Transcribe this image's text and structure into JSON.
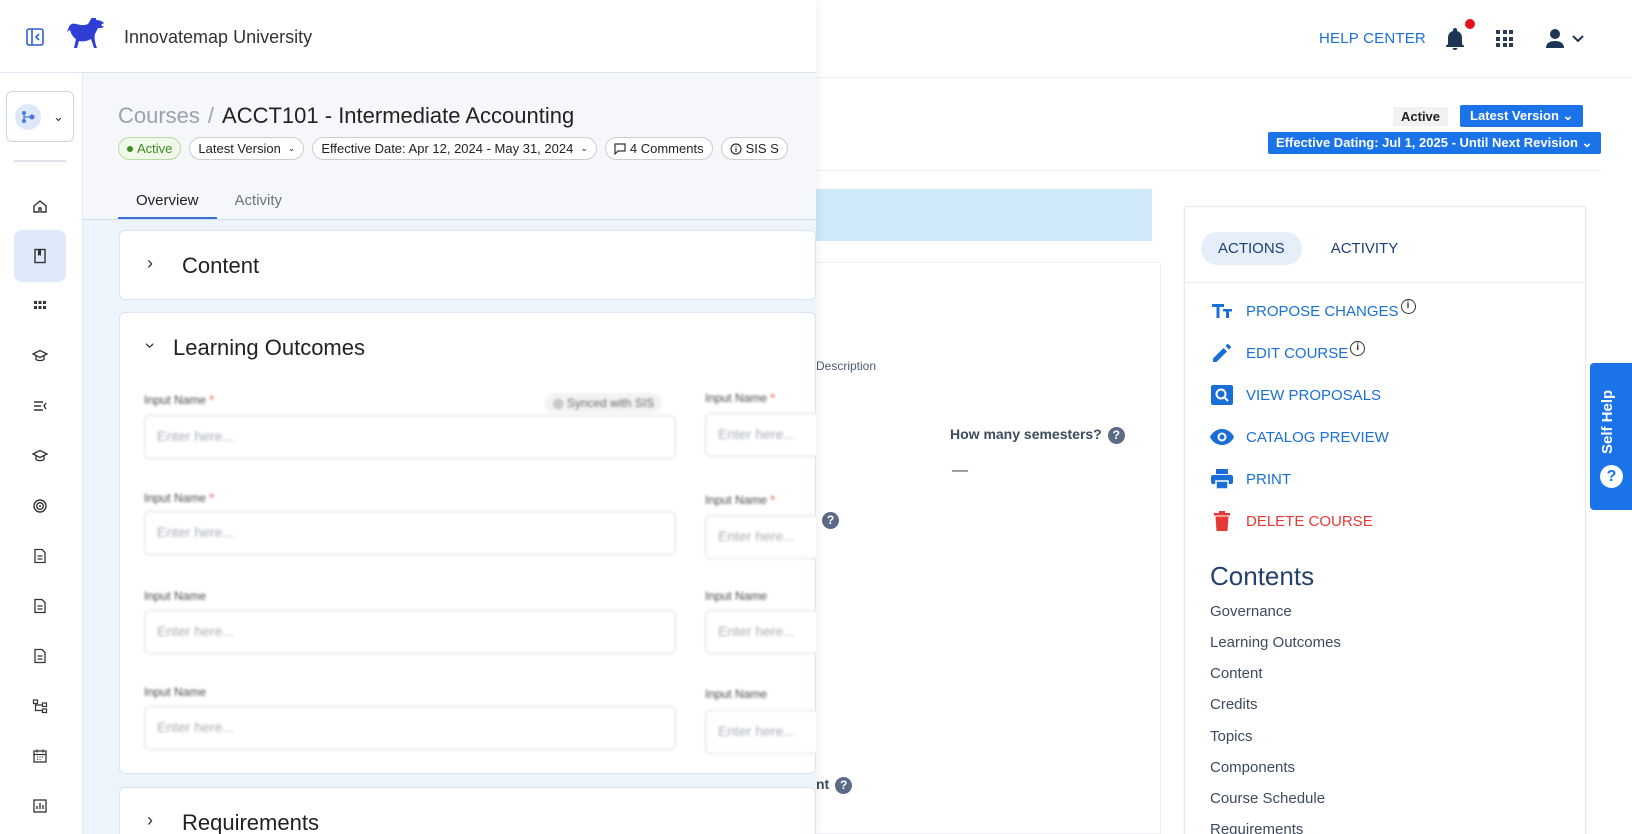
{
  "underlying": {
    "header": {
      "help_center": "HELP CENTER",
      "icons": [
        "bell-icon",
        "apps-grid-icon",
        "user-icon",
        "chevron-down-icon"
      ]
    },
    "status": {
      "active": "Active",
      "version": "Latest Version",
      "effective_dating": "Effective Dating: Jul 1, 2025 - Until Next Revision"
    },
    "form": {
      "description_label": "Description",
      "semesters_label": "How many semesters?",
      "semesters_value": "—",
      "partial_label": "nt"
    },
    "actions_panel": {
      "tabs": [
        "ACTIONS",
        "ACTIVITY"
      ],
      "items": [
        {
          "label": "PROPOSE CHANGES",
          "icon": "text-format-icon"
        },
        {
          "label": "EDIT COURSE",
          "icon": "pencil-icon"
        },
        {
          "label": "VIEW PROPOSALS",
          "icon": "search-box-icon"
        },
        {
          "label": "CATALOG PREVIEW",
          "icon": "eye-icon"
        },
        {
          "label": "PRINT",
          "icon": "printer-icon"
        },
        {
          "label": "DELETE COURSE",
          "icon": "trash-icon"
        }
      ],
      "contents_heading": "Contents",
      "contents": [
        "Governance",
        "Learning Outcomes",
        "Content",
        "Credits",
        "Topics",
        "Components",
        "Course Schedule",
        "Requirements"
      ]
    },
    "self_help": "Self Help",
    "colors": {
      "primary": "#1a73e8",
      "danger": "#e53935",
      "heading": "#24406d"
    }
  },
  "overlay": {
    "app_title": "Innovatemap University",
    "breadcrumb": {
      "parent": "Courses",
      "separator": "/",
      "current": "ACCT101 - Intermediate Accounting"
    },
    "chips": {
      "status": "Active",
      "version": "Latest Version",
      "effective": "Effective Date: Apr 12, 2024 - May 31, 2024",
      "comments": "4 Comments",
      "sis": "SIS S"
    },
    "tabs": {
      "overview": "Overview",
      "activity": "Activity"
    },
    "sections": {
      "content": "Content",
      "outcomes": "Learning Outcomes",
      "requirements": "Requirements"
    },
    "form": {
      "input_label": "Input Name",
      "placeholder": "Enter here...",
      "synced": "Synced with SIS"
    },
    "sidebar_icons": [
      "home-icon",
      "book-icon",
      "grid-icon",
      "graduation-cap-icon",
      "list-icon",
      "graduation-cap-icon",
      "target-icon",
      "document-icon",
      "document-icon",
      "document-icon",
      "hierarchy-icon",
      "calendar-icon",
      "chart-icon"
    ]
  }
}
